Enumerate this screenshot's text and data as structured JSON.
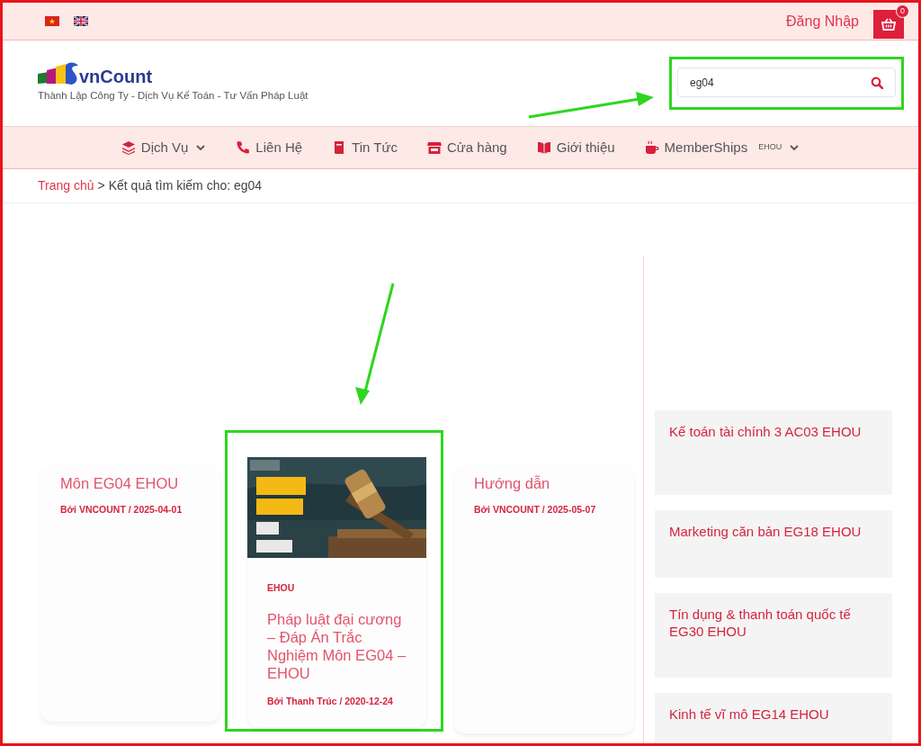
{
  "top_bar": {
    "languages": [
      {
        "kind": "vn"
      },
      {
        "kind": "uk"
      }
    ],
    "login": "Đăng Nhập",
    "cart_count": "0"
  },
  "header": {
    "logo_text": "vnCount",
    "tagline": "Thành Lập Công Ty - Dịch Vụ Kế Toán - Tư Vấn Pháp Luật",
    "search": {
      "value": "eg04",
      "highlighted": true
    }
  },
  "nav": [
    {
      "kind": "layers",
      "label": "Dịch Vụ",
      "dropdown": true
    },
    {
      "kind": "phone",
      "label": "Liên Hệ",
      "dropdown": false
    },
    {
      "kind": "book",
      "label": "Tin Tức",
      "dropdown": false
    },
    {
      "kind": "store",
      "label": "Cửa hàng",
      "dropdown": false
    },
    {
      "kind": "open-book",
      "label": "Giới thiệu",
      "dropdown": false
    },
    {
      "kind": "mug",
      "label": "MemberShips",
      "tag": "EHOU",
      "dropdown": true
    }
  ],
  "breadcrumb": {
    "home": "Trang chủ",
    "separator": ">",
    "current": "Kết quả tìm kiếm cho: eg04"
  },
  "posts": [
    {
      "title": "Môn EG04 EHOU",
      "byline": "Bởi VNCOUNT / 2025-04-01",
      "highlighted": false
    },
    {
      "category": "EHOU",
      "title": "Pháp luật đại cương – Đáp Án Trắc Nghiệm Môn EG04 – EHOU",
      "byline": "Bởi Thanh Trúc / 2020-12-24",
      "highlighted": true
    },
    {
      "title": "Hướng dẫn",
      "byline": "Bởi VNCOUNT / 2025-05-07",
      "highlighted": false
    }
  ],
  "sidebar_posts": [
    {
      "title": "Kế toán tài chính 3 AC03 EHOU"
    },
    {
      "title": "Marketing căn bản EG18 EHOU"
    },
    {
      "title": "Tín dụng & thanh toán quốc tế EG30 EHOU"
    },
    {
      "title": "Kinh tế vĩ mô EG14 EHOU"
    }
  ]
}
